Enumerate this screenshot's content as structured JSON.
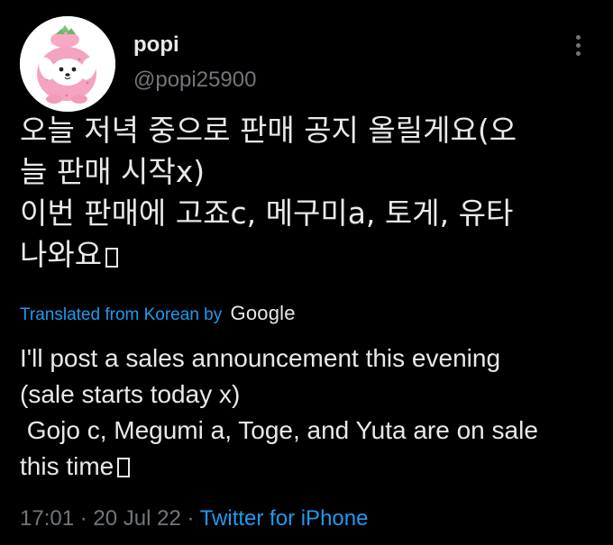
{
  "tweet": {
    "display_name": "popi",
    "handle": "@popi25900",
    "body_lines": [
      "오늘 저녁 중으로 판매 공지 올릴게요(오",
      "늘 판매 시작x)",
      "이번 판매에 고죠c, 메구미a, 토게, 유타",
      "나와요"
    ],
    "translated_from": "Translated from Korean by",
    "translator": "Google",
    "translation_lines": [
      "I'll post a sales announcement this evening",
      "(sale starts today x)",
      " Gojo c, Megumi a, Toge, and Yuta are on sale",
      "this time"
    ],
    "time": "17:01",
    "separator": " · ",
    "date": "20 Jul 22",
    "source": "Twitter for iPhone"
  },
  "colors": {
    "background": "#000000",
    "text": "#e7e9ea",
    "secondary": "#71767b",
    "accent": "#1d9bf0"
  },
  "icons": {
    "more": "more-vertical-icon",
    "avatar": "pink-dog-plush-avatar"
  }
}
